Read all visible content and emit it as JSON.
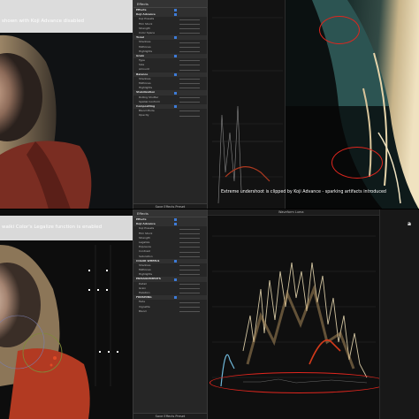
{
  "top": {
    "caption": "shown with Koji Advance disabled",
    "inspector_title": "Effects",
    "rows": [
      {
        "label": "Effects",
        "kind": "sec"
      },
      {
        "label": "Koji Advance",
        "kind": "sec"
      },
      {
        "label": "Koji Presets",
        "kind": "row"
      },
      {
        "label": "Film Stock",
        "kind": "row"
      },
      {
        "label": "Strength",
        "kind": "row"
      },
      {
        "label": "Color Space",
        "kind": "row"
      },
      {
        "label": "Tonal",
        "kind": "sec"
      },
      {
        "label": "Shadows",
        "kind": "row"
      },
      {
        "label": "Midtones",
        "kind": "row"
      },
      {
        "label": "Highlights",
        "kind": "row"
      },
      {
        "label": "Grain",
        "kind": "sec"
      },
      {
        "label": "Type",
        "kind": "row"
      },
      {
        "label": "Size",
        "kind": "row"
      },
      {
        "label": "Amount",
        "kind": "row"
      },
      {
        "label": "Balance",
        "kind": "sec"
      },
      {
        "label": "Shadows",
        "kind": "row"
      },
      {
        "label": "Midtones",
        "kind": "row"
      },
      {
        "label": "Highlights",
        "kind": "row"
      },
      {
        "label": "Stabilization",
        "kind": "sec"
      },
      {
        "label": "Rolling Shutter",
        "kind": "row"
      },
      {
        "label": "Spatial Conform",
        "kind": "row"
      },
      {
        "label": "Compositing",
        "kind": "sec"
      },
      {
        "label": "Blend Mode",
        "kind": "row"
      },
      {
        "label": "Opacity",
        "kind": "row"
      }
    ],
    "footer": "Save Effects Preset",
    "scope_caption": "Extreme undershoot is clipped by Koji Advance - sparking artifacts introduced"
  },
  "bottom": {
    "caption": "waiki Color's Legalize function is enabled",
    "inspector_title": "Effects",
    "rows": [
      {
        "label": "Effects",
        "kind": "sec"
      },
      {
        "label": "Koji Advance",
        "kind": "sec"
      },
      {
        "label": "Koji Presets",
        "kind": "row"
      },
      {
        "label": "Film Stock",
        "kind": "row"
      },
      {
        "label": "Strength",
        "kind": "row"
      },
      {
        "label": "Legalize",
        "kind": "row"
      },
      {
        "label": "Exposure",
        "kind": "row"
      },
      {
        "label": "Contrast",
        "kind": "row"
      },
      {
        "label": "Saturation",
        "kind": "row"
      },
      {
        "label": "COLOR WHEELS",
        "kind": "sec"
      },
      {
        "label": "Shadows",
        "kind": "row"
      },
      {
        "label": "Midtones",
        "kind": "row"
      },
      {
        "label": "Highlights",
        "kind": "row"
      },
      {
        "label": "ENHANCEMENTS",
        "kind": "sec"
      },
      {
        "label": "Detail",
        "kind": "row"
      },
      {
        "label": "Grain",
        "kind": "row"
      },
      {
        "label": "Halation",
        "kind": "row"
      },
      {
        "label": "FINISHING",
        "kind": "sec"
      },
      {
        "label": "Fade",
        "kind": "row"
      },
      {
        "label": "Vignette",
        "kind": "row"
      },
      {
        "label": "Blend",
        "kind": "row"
      }
    ],
    "footer": "Save Effects Preset",
    "scope_title": "Waveform Luma",
    "top_right_letter": "a"
  },
  "colors": {
    "highlight_circle": "#e0261e",
    "scope_trace": "#e8d8b0",
    "red_trace": "#d23a1a",
    "blue_trace": "#6fb7d8"
  }
}
